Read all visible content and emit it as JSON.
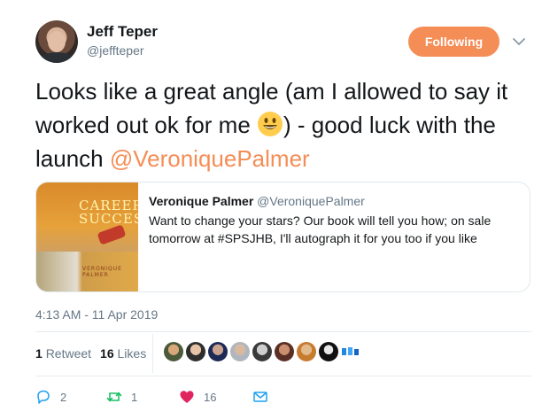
{
  "author": {
    "name": "Jeff Teper",
    "handle": "@jeffteper"
  },
  "follow_button": {
    "label": "Following"
  },
  "tweet": {
    "text_part1": "Looks like a great angle (am I allowed to say it worked out ok for me ",
    "text_part2": ") - good luck with the launch ",
    "mention": "@VeroniquePalmer"
  },
  "quoted_tweet": {
    "name": "Veronique Palmer",
    "handle": "@VeroniquePalmer",
    "text": "Want to change your stars? Our book will tell you how; on sale tomorrow at #SPSJHB, I'll autograph it for you too if you like",
    "image": {
      "book_title": "CAREER SUCCESS",
      "book_author": "VERONIQUE PALMER"
    }
  },
  "timestamp": "4:13 AM - 11 Apr 2019",
  "stats": {
    "retweets_count": "1",
    "retweets_label": "Retweet",
    "likes_count": "16",
    "likes_label": "Likes"
  },
  "actions": {
    "reply_count": "2",
    "retweet_count": "1",
    "like_count": "16"
  },
  "colors": {
    "accent": "#f58d56",
    "like": "#e0245e",
    "retweet": "#17bf63",
    "reply": "#1da1f2"
  }
}
